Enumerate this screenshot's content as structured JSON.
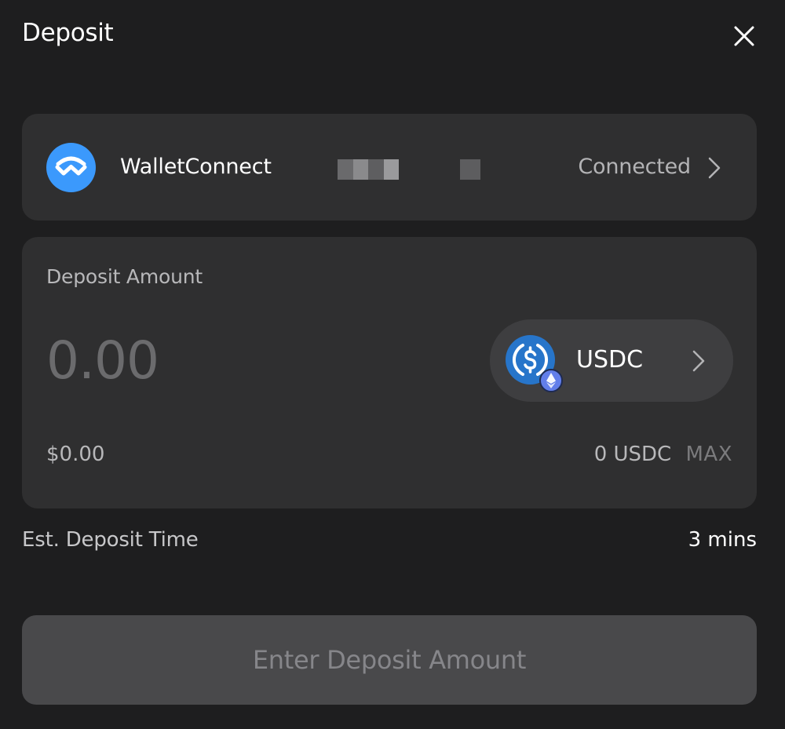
{
  "modal": {
    "title": "Deposit"
  },
  "wallet": {
    "name": "WalletConnect",
    "status": "Connected",
    "logo_color": "#3b99fc",
    "icons": {
      "logo": "walletconnect-logo-icon",
      "chevron": "chevron-right-icon"
    }
  },
  "deposit": {
    "label": "Deposit Amount",
    "amount_placeholder": "0.00",
    "usd_value": "$0.00",
    "balance": "0 USDC",
    "max_label": "MAX",
    "token": {
      "symbol": "USDC",
      "icon": "usdc-icon",
      "network_icon": "ethereum-icon",
      "color": "#2775ca"
    }
  },
  "estimate": {
    "label": "Est. Deposit Time",
    "value": "3 mins"
  },
  "submit": {
    "label": "Enter Deposit Amount",
    "disabled": true
  },
  "colors": {
    "background": "#1e1e1f",
    "card": "#2f2f30",
    "pill": "#3e3e40",
    "button_disabled": "#49494b"
  }
}
